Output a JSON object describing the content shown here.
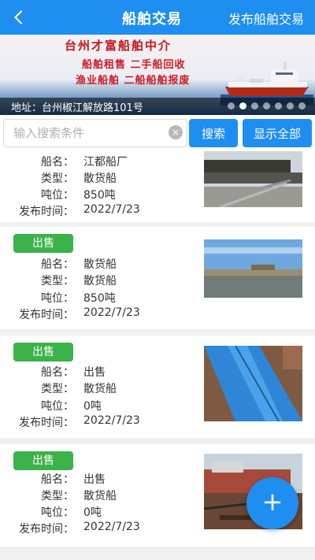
{
  "header": {
    "title": "船舶交易",
    "publish_label": "发布船舶交易"
  },
  "banner": {
    "title": "台州才富船舶中介",
    "line1": "船舶租售  二手船回收",
    "line2": "渔业船舶  二船船舶报废",
    "address": "地址：台州椒江解放路101号",
    "slide_count": 7,
    "active_slide": 2
  },
  "search": {
    "placeholder": "输入搜索条件",
    "value": "",
    "clear_symbol": "×",
    "search_label": "搜索",
    "show_all_label": "显示全部"
  },
  "labels": {
    "name": "船名：",
    "type": "类型：",
    "tonnage": "吨位：",
    "date": "发布时间："
  },
  "listings": [
    {
      "badge": "",
      "name": "江都船厂",
      "type": "散货船",
      "tonnage": "850吨",
      "date": "2022/7/23"
    },
    {
      "badge": "出售",
      "name": "散货船",
      "type": "散货船",
      "tonnage": "850吨",
      "date": "2022/7/23"
    },
    {
      "badge": "出售",
      "name": "出售",
      "type": "散货船",
      "tonnage": "0吨",
      "date": "2022/7/23"
    },
    {
      "badge": "出售",
      "name": "出售",
      "type": "散货船",
      "tonnage": "0吨",
      "date": "2022/7/23"
    }
  ],
  "fab": {
    "symbol": "+"
  },
  "colors": {
    "primary": "#1e8ff0",
    "badge": "#3cb24a",
    "banner_text": "#d21a24"
  }
}
